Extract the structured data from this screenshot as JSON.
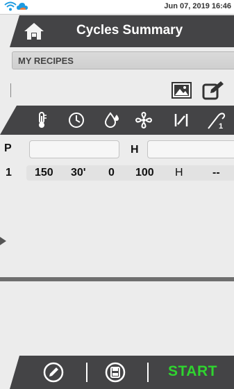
{
  "status": {
    "datetime": "Jun 07, 2019 16:46",
    "wifi_icon": "wifi-icon",
    "cloud_icon": "cloud-icon"
  },
  "header": {
    "title": "Cycles Summary",
    "home_icon": "home-icon"
  },
  "recipes": {
    "label": "MY RECIPES"
  },
  "toolbar": {
    "image_icon": "image-icon",
    "edit_icon": "edit-icon"
  },
  "param_icons": [
    "thermometer-icon",
    "clock-icon",
    "humidity-icon",
    "fan-icon",
    "steam-valve-icon",
    "probe-icon"
  ],
  "probe_number": "1",
  "rows": {
    "p_label": "P",
    "h_label": "H"
  },
  "step": {
    "index": "1",
    "temperature": "150",
    "time": "30'",
    "humidity": "0",
    "fan": "100",
    "valve": "H",
    "probe": "--"
  },
  "footer": {
    "start_label": "START",
    "edit_icon": "pencil-icon",
    "save_icon": "save-icon"
  },
  "colors": {
    "bar_dark": "#444446",
    "start_green": "#2fd42f",
    "background": "#ececec"
  }
}
